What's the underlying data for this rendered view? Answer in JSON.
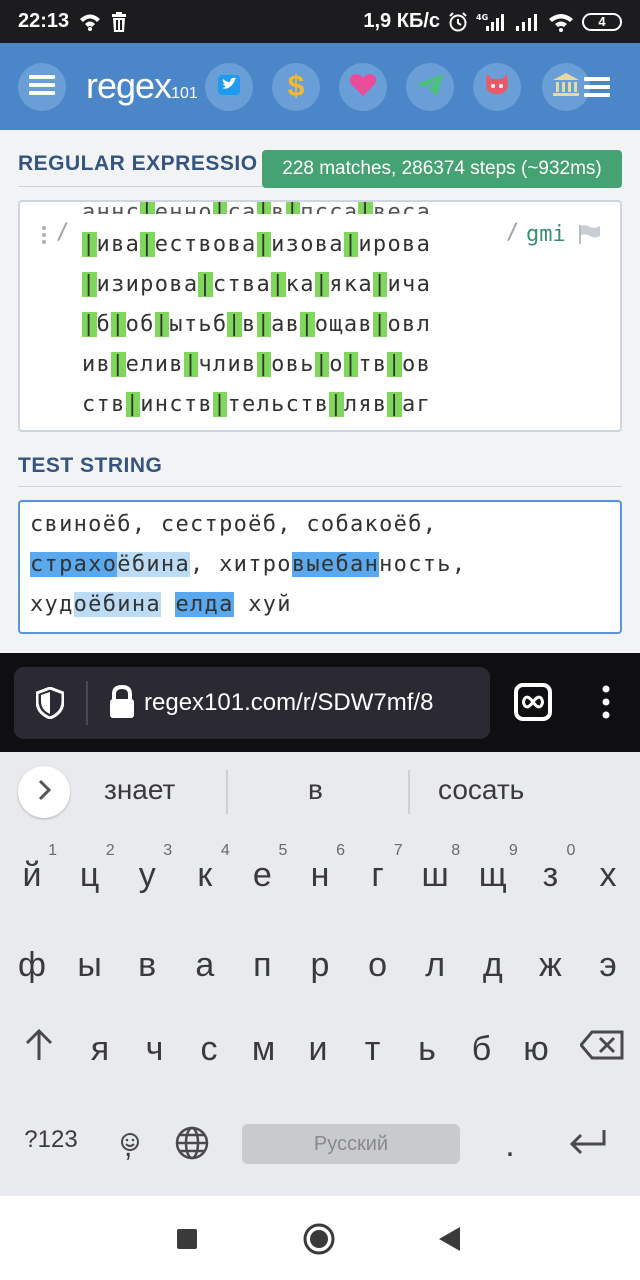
{
  "status_bar": {
    "time": "22:13",
    "net_speed": "1,9 КБ/с",
    "battery": "4",
    "icons": [
      "wifi-icon",
      "trash-icon",
      "alarm-icon",
      "signal-4g-icon",
      "signal-icon",
      "wifi-icon",
      "battery-icon"
    ]
  },
  "header": {
    "logo_main": "regex",
    "logo_suffix": "101",
    "buttons": [
      "menu-icon",
      "twitter-icon",
      "dollar-icon",
      "heart-icon",
      "telegram-icon",
      "github-icon",
      "library-icon",
      "menu-icon"
    ]
  },
  "regex_section": {
    "title": "REGULAR EXPRESSION",
    "match_info": "228 matches, 286374 steps (~932ms)",
    "delimiter_open": "/",
    "delimiter_close": "/",
    "flags": "gmi",
    "lines": [
      [
        {
          "t": "|"
        },
        {
          "t": "ива"
        },
        {
          "t": "|"
        },
        {
          "t": "ествова"
        },
        {
          "t": "|"
        },
        {
          "t": "изова"
        },
        {
          "t": "|"
        },
        {
          "t": "ирова"
        }
      ],
      [
        {
          "t": "|"
        },
        {
          "t": "изирова"
        },
        {
          "t": "|"
        },
        {
          "t": "ства"
        },
        {
          "t": "|"
        },
        {
          "t": "ка"
        },
        {
          "t": "|"
        },
        {
          "t": "яка"
        },
        {
          "t": "|"
        },
        {
          "t": "ича"
        }
      ],
      [
        {
          "t": "|"
        },
        {
          "t": "б"
        },
        {
          "t": "|"
        },
        {
          "t": "об"
        },
        {
          "t": "|"
        },
        {
          "t": "ытьб"
        },
        {
          "t": "|"
        },
        {
          "t": "в"
        },
        {
          "t": "|"
        },
        {
          "t": "ав"
        },
        {
          "t": "|"
        },
        {
          "t": "ощав"
        },
        {
          "t": "|"
        },
        {
          "t": "овл"
        }
      ],
      [
        {
          "t": "ив"
        },
        {
          "t": "|"
        },
        {
          "t": "елив"
        },
        {
          "t": "|"
        },
        {
          "t": "члив"
        },
        {
          "t": "|"
        },
        {
          "t": "овь"
        },
        {
          "t": "|"
        },
        {
          "t": "о"
        },
        {
          "t": "|"
        },
        {
          "t": "тв"
        },
        {
          "t": "|"
        },
        {
          "t": "ов"
        }
      ],
      [
        {
          "t": "ств"
        },
        {
          "t": "|"
        },
        {
          "t": "инств"
        },
        {
          "t": "|"
        },
        {
          "t": "тельств"
        },
        {
          "t": "|"
        },
        {
          "t": "ляв"
        },
        {
          "t": "|"
        },
        {
          "t": "аг"
        }
      ]
    ]
  },
  "test_section": {
    "title": "TEST STRING",
    "lines": [
      [
        {
          "t": "свиноёб, сестроёб, собакоёб,",
          "h": 0
        }
      ],
      [
        {
          "t": "страхо",
          "h": 1
        },
        {
          "t": "ёбина",
          "h": 2
        },
        {
          "t": ", хитро",
          "h": 0
        },
        {
          "t": "выебан",
          "h": 1
        },
        {
          "t": "ность,",
          "h": 0
        }
      ],
      [
        {
          "t": "худ",
          "h": 0
        },
        {
          "t": "оёбина",
          "h": 2
        },
        {
          "t": " ",
          "h": 0
        },
        {
          "t": "елда",
          "h": 1
        },
        {
          "t": " хуй",
          "h": 0
        }
      ]
    ]
  },
  "browser": {
    "url": "regex101.com/r/SDW7mf/8",
    "tab_icon": "tabs-infinity-icon"
  },
  "suggestions": [
    "знает",
    "в",
    "сосать"
  ],
  "keyboard": {
    "row1": [
      "й",
      "ц",
      "у",
      "к",
      "е",
      "н",
      "г",
      "ш",
      "щ",
      "з",
      "х"
    ],
    "row1_hints": [
      "1",
      "2",
      "3",
      "4",
      "5",
      "6",
      "7",
      "8",
      "9",
      "0",
      ""
    ],
    "row2": [
      "ф",
      "ы",
      "в",
      "а",
      "п",
      "р",
      "о",
      "л",
      "д",
      "ж",
      "э"
    ],
    "row3": [
      "я",
      "ч",
      "с",
      "м",
      "и",
      "т",
      "ь",
      "б",
      "ю"
    ],
    "symbols_key": "?123",
    "space_label": "Русский",
    "period": ".",
    "comma": ","
  },
  "colors": {
    "header_blue": "#4a86c8",
    "match_green": "#45a273",
    "pipe_highlight": "#7fd85b",
    "match_blue": "#5aa9ee",
    "match_light_blue": "#bcdcf6",
    "section_title": "#35557f"
  }
}
